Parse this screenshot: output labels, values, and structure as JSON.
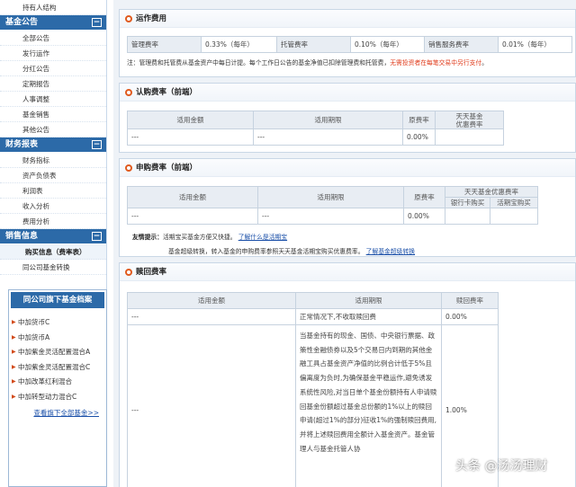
{
  "sidebar": {
    "top_item": "持有人结构",
    "sections": [
      {
        "title": "基金公告",
        "collapse_symbol": "⊟",
        "items": [
          "全部公告",
          "发行运作",
          "分红公告",
          "定期报告",
          "人事调整",
          "基金销售",
          "其他公告"
        ]
      },
      {
        "title": "财务报表",
        "collapse_symbol": "⊟",
        "items": [
          "财务指标",
          "资产负债表",
          "利润表",
          "收入分析",
          "费用分析"
        ]
      },
      {
        "title": "销售信息",
        "collapse_symbol": "⊟",
        "items": [
          "购买信息（费率表）",
          "同公司基金转换"
        ]
      }
    ],
    "fund_box": {
      "title": "同公司旗下基金档案",
      "funds": [
        "中加货币C",
        "中加货币A",
        "中加紫金灵活配置混合A",
        "中加紫金灵活配置混合C",
        "中加改革红利混合",
        "中加转型动力混合C"
      ],
      "more_label": "查看旗下全部基金>>"
    }
  },
  "operating_fees": {
    "title": "运作费用",
    "rows": [
      {
        "label": "管理费率",
        "value": "0.33%（每年）"
      },
      {
        "label": "托管费率",
        "value": "0.10%（每年）"
      },
      {
        "label": "销售服务费率",
        "value": "0.01%（每年）"
      }
    ],
    "note_prefix": "注：管理费和托管费从基金资产中每日计提。每个工作日公告的基金净值已扣除管理费和托管费，",
    "note_red": "无需投资者在每笔交易中另行支付",
    "note_suffix": "。"
  },
  "subscription": {
    "title": "认购费率（前端）",
    "headers": [
      "适用金额",
      "适用期限",
      "原费率",
      "天天基金\n优惠费率"
    ],
    "rows": [
      [
        "---",
        "---",
        "0.00%",
        ""
      ]
    ]
  },
  "purchase": {
    "title": "申购费率（前端）",
    "headers": [
      "适用金额",
      "适用期限",
      "原费率",
      "天天基金优惠费率",
      "银行卡购买",
      "活期宝购买"
    ],
    "rows": [
      [
        "---",
        "---",
        "0.00%",
        "",
        ""
      ]
    ],
    "tip_label": "友情提示：",
    "tip_text": "活期宝买基金方便又快捷。",
    "tip_link": "了解什么是活期宝",
    "tip2_text": "基金超级转换，转入基金的申购费率参照天天基金活期宝购买优惠费率。",
    "tip2_link": "了解基金超级转换"
  },
  "redemption": {
    "title": "赎回费率",
    "headers": [
      "适用金额",
      "适用期限",
      "赎回费率"
    ],
    "rows": [
      {
        "amount": "---",
        "period": "正常情况下,不收取赎回费",
        "rate": "0.00%"
      },
      {
        "amount": "---",
        "period": "当基金持有的现金、国债、中央银行票据、政策性金融债券以及5个交易日内到期的其他金融工具占基金资产净值的比例合计低于5%且偏离度为负时,为确保基金平稳运作,避免诱发系统性风险,对当日单个基金份额持有人申请赎回基金份额超过基金总份额的1%以上的赎回申请(超过1%的部分)征收1%的强制赎回费用,并将上述赎回费用全额计入基金资产。基金管理人与基金托管人协",
        "rate": "1.00%"
      }
    ]
  },
  "watermark": "头条 @汤汤理财"
}
